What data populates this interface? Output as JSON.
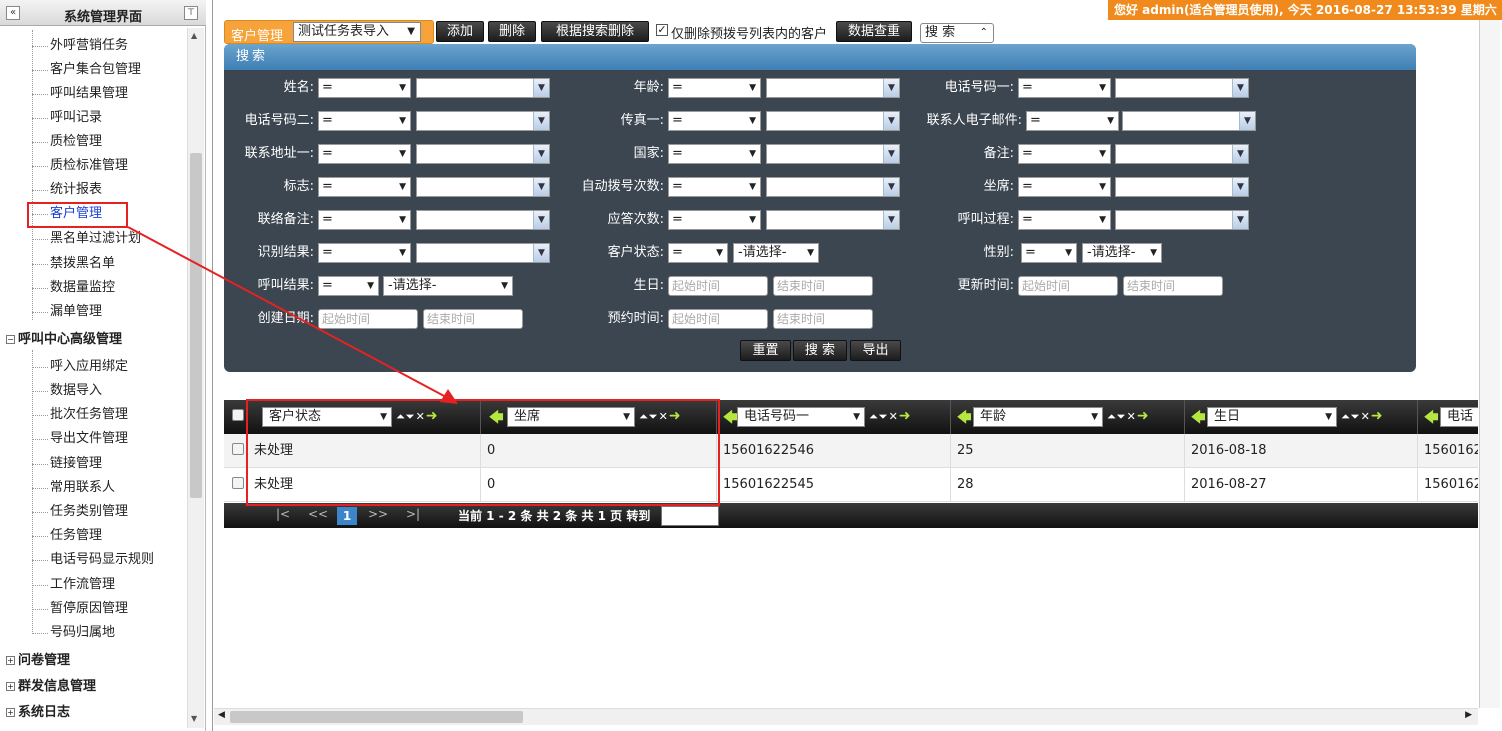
{
  "sidebar": {
    "title": "系统管理界面",
    "collapse_icon": "double-left-chevron",
    "pin_icon": "pin-icon",
    "items": [
      {
        "label": "外呼营销任务"
      },
      {
        "label": "客户集合包管理"
      },
      {
        "label": "呼叫结果管理"
      },
      {
        "label": "呼叫记录"
      },
      {
        "label": "质检管理"
      },
      {
        "label": "质检标准管理"
      },
      {
        "label": "统计报表"
      },
      {
        "label": "客户管理"
      },
      {
        "label": "黑名单过滤计划"
      },
      {
        "label": "禁拨黑名单"
      },
      {
        "label": "数据量监控"
      },
      {
        "label": "漏单管理"
      }
    ],
    "group2": {
      "label": "呼叫中心高级管理",
      "items": [
        {
          "label": "呼入应用绑定"
        },
        {
          "label": "数据导入"
        },
        {
          "label": "批次任务管理"
        },
        {
          "label": "导出文件管理"
        },
        {
          "label": "链接管理"
        },
        {
          "label": "常用联系人"
        },
        {
          "label": "任务类别管理"
        },
        {
          "label": "任务管理"
        },
        {
          "label": "电话号码显示规则"
        },
        {
          "label": "工作流管理"
        },
        {
          "label": "暂停原因管理"
        },
        {
          "label": "号码归属地"
        }
      ]
    },
    "groups_collapsed": [
      {
        "label": "问卷管理"
      },
      {
        "label": "群发信息管理"
      },
      {
        "label": "系统日志"
      }
    ]
  },
  "topbar": {
    "text": "您好 admin(适合管理员使用), 今天 2016-08-27 13:53:39 星期六"
  },
  "toolbar": {
    "tab_label": "客户管理",
    "task_select": "测试任务表导入",
    "add_label": "添加",
    "delete_label": "删除",
    "delete_by_search_label": "根据搜索删除",
    "only_predial_label": "仅删除预拨号列表内的客户",
    "dedupe_label": "数据查重",
    "search_toggle_label": "搜 索"
  },
  "search": {
    "header": "搜索",
    "op_eq": "=",
    "please_select": "-请选择-",
    "start_time": "起始时间",
    "end_time": "结束时间",
    "fields": {
      "name": "姓名:",
      "age": "年龄:",
      "phone1": "电话号码一:",
      "phone2": "电话号码二:",
      "fax1": "传真一:",
      "email": "联系人电子邮件:",
      "addr1": "联系地址一:",
      "country": "国家:",
      "remark": "备注:",
      "flag": "标志:",
      "autodial": "自动拨号次数:",
      "seat": "坐席:",
      "link_remark": "联络备注:",
      "answer": "应答次数:",
      "call_process": "呼叫过程:",
      "recog": "识别结果:",
      "cust_status": "客户状态:",
      "gender": "性别:",
      "call_result": "呼叫结果:",
      "birthday": "生日:",
      "update_time": "更新时间:",
      "create_date": "创建日期:",
      "appoint_time": "预约时间:"
    },
    "reset_label": "重置",
    "search_label": "搜 索",
    "export_label": "导出"
  },
  "grid": {
    "columns": [
      {
        "label": "客户状态"
      },
      {
        "label": "坐席"
      },
      {
        "label": "电话号码一"
      },
      {
        "label": "年龄"
      },
      {
        "label": "生日"
      },
      {
        "label": "电话"
      }
    ],
    "rows": [
      {
        "status": "未处理",
        "seat": "0",
        "phone": "15601622546",
        "age": "25",
        "birthday": "2016-08-18",
        "phone_b": "1560162"
      },
      {
        "status": "未处理",
        "seat": "0",
        "phone": "15601622545",
        "age": "28",
        "birthday": "2016-08-27",
        "phone_b": "1560162"
      }
    ],
    "pager": {
      "first": "|<",
      "prev": "<<",
      "current": "1",
      "next": ">>",
      "last": ">|",
      "info": "当前 1 - 2 条 共 2 条 共 1 页 转到"
    }
  },
  "colors": {
    "accent_orange": "#f6a33b",
    "highlight_red": "#e52222",
    "panel_dark": "#3c4650",
    "header_blue": "#4a8bc0"
  }
}
